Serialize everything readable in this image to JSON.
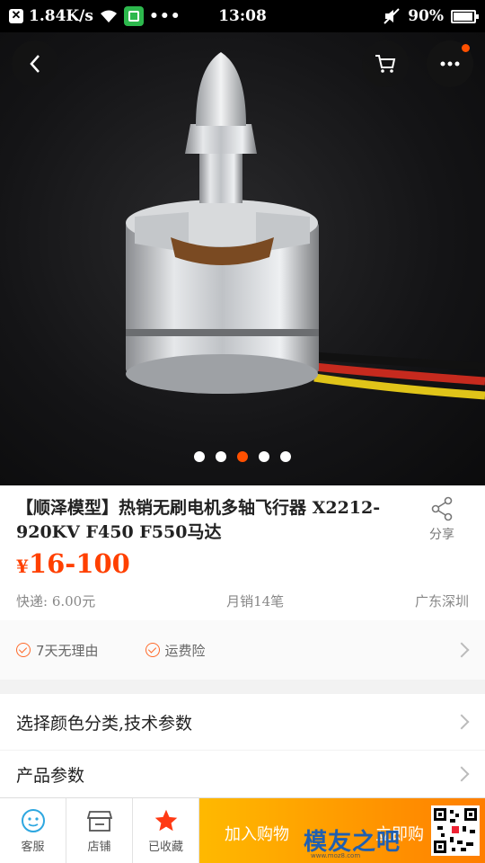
{
  "status_bar": {
    "speed": "1.84K/s",
    "dots": "•••",
    "time": "13:08",
    "battery": "90%"
  },
  "product": {
    "title": "【顺泽模型】热销无刷电机多轴飞行器 X2212-920KV F450 F550马达",
    "price_currency": "¥",
    "price_range": "16-100",
    "shipping": "快递: 6.00元",
    "monthly_sales": "月销14笔",
    "location": "广东深圳",
    "gallery_count": 5,
    "gallery_active_index": 3
  },
  "share": {
    "label": "分享"
  },
  "services": [
    {
      "label": "7天无理由"
    },
    {
      "label": "运费险"
    }
  ],
  "rows": {
    "select_options": "选择颜色分类,技术参数",
    "params": "产品参数"
  },
  "bottom_bar": {
    "service_label": "客服",
    "store_label": "店铺",
    "favorited_label": "已收藏",
    "add_to_cart": "加入购物",
    "buy_now": "立即购",
    "watermark": "模友之吧",
    "watermark_url": "www.moz8.com"
  },
  "colors": {
    "accent": "#ff5000",
    "price": "#ff4000",
    "add_to_cart_from": "#ffb900",
    "add_to_cart_to": "#ff7e00"
  }
}
